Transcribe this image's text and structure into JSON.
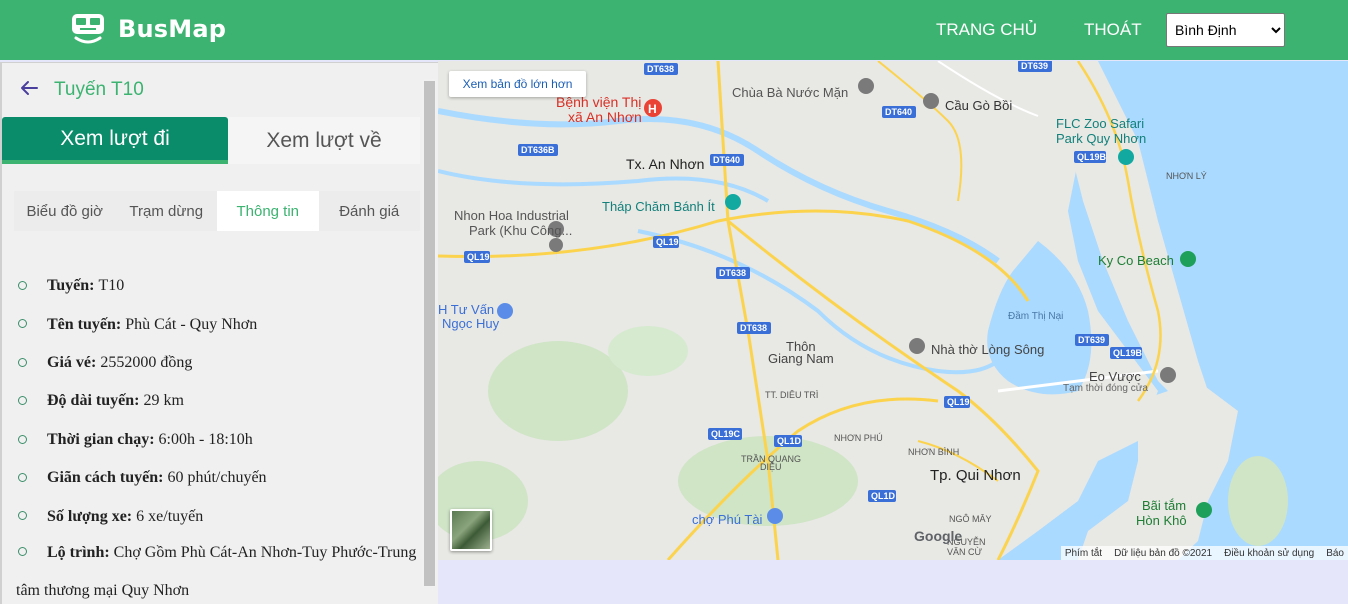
{
  "header": {
    "brand": "BusMap",
    "nav_home": "TRANG CHỦ",
    "nav_logout": "THOÁT",
    "province_selected": "Bình Định",
    "colors": {
      "brand_green": "#3cb371",
      "active_tab": "#0a8b6a"
    }
  },
  "sidebar": {
    "route_title": "Tuyến T10",
    "direction_tabs": [
      "Xem lượt đi",
      "Xem lượt về"
    ],
    "sub_tabs": [
      "Biểu đồ giờ",
      "Trạm dừng",
      "Thông tin",
      "Đánh giá"
    ],
    "active_sub_tab": "Thông tin",
    "info": [
      {
        "label": "Tuyến:",
        "value": "T10"
      },
      {
        "label": "Tên tuyến:",
        "value": "Phù Cát - Quy Nhơn"
      },
      {
        "label": "Giá vé:",
        "value": "2552000 đồng"
      },
      {
        "label": "Độ dài tuyến:",
        "value": "29 km"
      },
      {
        "label": "Thời gian chạy:",
        "value": "6:00h - 18:10h"
      },
      {
        "label": "Giãn cách tuyến:",
        "value": "60 phút/chuyến"
      },
      {
        "label": "Số lượng xe:",
        "value": "6 xe/tuyến"
      },
      {
        "label": "Lộ trình:",
        "value": "Chợ Gồm Phù Cát-An Nhơn-Tuy Phước-Trung",
        "value_cont": "tâm thương mại Quy Nhơn"
      }
    ]
  },
  "map": {
    "larger_map_button": "Xem bản đồ lớn hơn",
    "google_logo": "Google",
    "attribution": [
      "Phím tắt",
      "Dữ liệu bản đồ ©2021",
      "Điều khoản sử dụng",
      "Báo"
    ],
    "places": [
      "Bệnh viện Thị",
      "xã An Nhơn",
      "Chùa Bà Nước Mặn",
      "Cầu Gò Bồi",
      "FLC Zoo Safari",
      "Park Quy Nhơn",
      "NHƠN LÝ",
      "Tx. An Nhơn",
      "Tháp Chăm Bánh Ít",
      "Nhon Hoa Industrial",
      "Park (Khu Công...",
      "Ky Co Beach",
      "H Tư Vấn",
      "Ngọc Huy",
      "Đầm Thị Nại",
      "Thôn",
      "Giang Nam",
      "Nhà thờ Lòng Sông",
      "Eo Vược",
      "Tạm thời đóng cửa",
      "TT. DIÊU TRÌ",
      "NHƠN PHÚ",
      "NHƠN BÌNH",
      "TRẦN QUANG",
      "DIỆU",
      "Tp. Qui Nhơn",
      "chợ Phú Tài",
      "NGÔ MÂY",
      "NGUYỄN",
      "VĂN CỪ",
      "Bãi tắm",
      "Hòn Khô"
    ],
    "road_shields": [
      "DT638",
      "DT639",
      "DT640",
      "DT640",
      "DT636B",
      "QL19",
      "QL19",
      "DT638",
      "DT638",
      "QL19B",
      "DT639",
      "QL19B",
      "QL19",
      "QL19C",
      "QL1D",
      "QL1D"
    ]
  }
}
